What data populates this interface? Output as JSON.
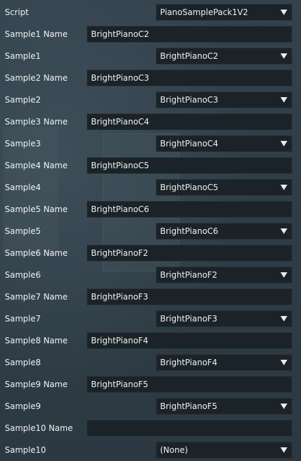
{
  "inspector": {
    "script_row": {
      "label": "Script",
      "value": "PianoSamplePack1V2"
    },
    "samples": [
      {
        "name_label": "Sample1 Name",
        "name_value": "BrightPianoC2",
        "sample_label": "Sample1",
        "sample_value": "BrightPianoC2"
      },
      {
        "name_label": "Sample2 Name",
        "name_value": "BrightPianoC3",
        "sample_label": "Sample2",
        "sample_value": "BrightPianoC3"
      },
      {
        "name_label": "Sample3 Name",
        "name_value": "BrightPianoC4",
        "sample_label": "Sample3",
        "sample_value": "BrightPianoC4"
      },
      {
        "name_label": "Sample4 Name",
        "name_value": "BrightPianoC5",
        "sample_label": "Sample4",
        "sample_value": "BrightPianoC5"
      },
      {
        "name_label": "Sample5 Name",
        "name_value": "BrightPianoC6",
        "sample_label": "Sample5",
        "sample_value": "BrightPianoC6"
      },
      {
        "name_label": "Sample6 Name",
        "name_value": "BrightPianoF2",
        "sample_label": "Sample6",
        "sample_value": "BrightPianoF2"
      },
      {
        "name_label": "Sample7 Name",
        "name_value": "BrightPianoF3",
        "sample_label": "Sample7",
        "sample_value": "BrightPianoF3"
      },
      {
        "name_label": "Sample8 Name",
        "name_value": "BrightPianoF4",
        "sample_label": "Sample8",
        "sample_value": "BrightPianoF4"
      },
      {
        "name_label": "Sample9 Name",
        "name_value": "BrightPianoF5",
        "sample_label": "Sample9",
        "sample_value": "BrightPianoF5"
      },
      {
        "name_label": "Sample10 Name",
        "name_value": "",
        "sample_label": "Sample10",
        "sample_value": "(None)"
      }
    ]
  },
  "icons": {
    "dropdown_arrow": "chevron-down-icon"
  },
  "colors": {
    "panel_background": "#2f3d47",
    "field_background": "#1b2328",
    "text": "#eef2f4"
  }
}
